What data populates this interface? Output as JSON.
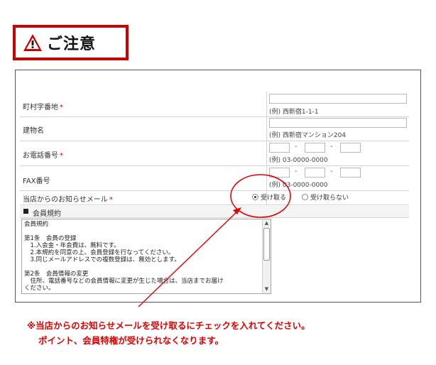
{
  "banner": {
    "title": "ご注意",
    "icon": "warning-triangle-icon"
  },
  "form": {
    "address": {
      "label": "町村字番地",
      "required": "*",
      "hint": "(例) 西新宿1-1-1"
    },
    "building": {
      "label": "建物名",
      "hint": "(例) 西新宿マンション204"
    },
    "phone": {
      "label": "お電話番号",
      "required": "*",
      "sep1": "-",
      "sep2": "-",
      "hint": "(例) 03-0000-0000"
    },
    "fax": {
      "label": "FAX番号",
      "sep1": "-",
      "sep2": "-",
      "hint": "(例) 03-0000-0000"
    },
    "newsletter": {
      "label": "当店からのお知らせメール",
      "required": "*",
      "options": [
        "受け取る",
        "受け取らない"
      ],
      "selected": "受け取る"
    },
    "terms_section": {
      "title": "会員規約"
    },
    "terms_text": [
      "会員規約",
      "",
      "第1条　会員の登録",
      "　1.入会金・年会費は、無料です。",
      "　2.本規約を同意の上、会員登録を行なってください。",
      "　3.同じメールアドレスでの複数登録は、無効とします。",
      "",
      "第2条　会員情報の変更",
      "　住所、電話番号などの会員情報に変更が生じた場合は、当店までお届け",
      "ください。"
    ]
  },
  "notice": {
    "line1": "※当店からのお知らせメールを受け取るにチェックを入れてください。",
    "line2": "ポイント、会員特権が受けられなくなります。"
  },
  "colors": {
    "accent": "#cc0000",
    "annotation": "#e00000"
  }
}
